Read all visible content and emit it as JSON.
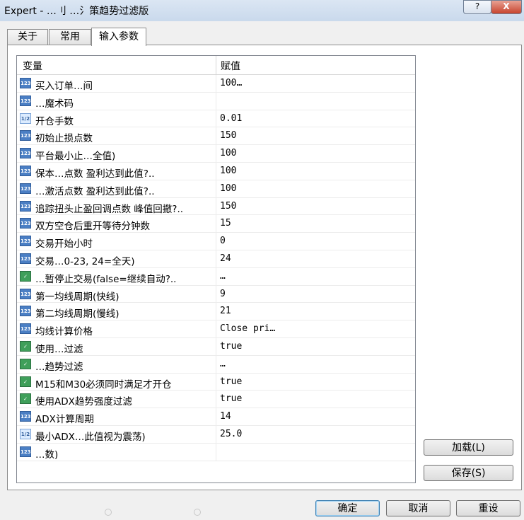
{
  "window": {
    "title": "Expert - …刂  …氵策趋势过滤版",
    "help_label": "?",
    "close_label": "X"
  },
  "tabs": [
    {
      "label": "关于"
    },
    {
      "label": "常用"
    },
    {
      "label": "输入参数"
    }
  ],
  "table": {
    "col_variable": "变量",
    "col_value": "赋值",
    "rows": [
      {
        "icon": "int-icon",
        "name": "买入订单…间",
        "value": "100…"
      },
      {
        "icon": "int-icon",
        "name": "…魔术码",
        "value": ""
      },
      {
        "icon": "double-icon",
        "name": "开仓手数",
        "value": "0.01"
      },
      {
        "icon": "int-icon",
        "name": "初始止损点数",
        "value": "150"
      },
      {
        "icon": "int-icon",
        "name": "平台最小止…全值)",
        "value": "100"
      },
      {
        "icon": "int-icon",
        "name": "保本…点数 盈利达到此值?..",
        "value": "100"
      },
      {
        "icon": "int-icon",
        "name": "…激活点数 盈利达到此值?..",
        "value": "100"
      },
      {
        "icon": "int-icon",
        "name": "追踪扭头止盈回调点数 峰值回撤?..",
        "value": "150"
      },
      {
        "icon": "int-icon",
        "name": "双方空仓后重开等待分钟数",
        "value": "15"
      },
      {
        "icon": "int-icon",
        "name": "交易开始小时",
        "value": "0"
      },
      {
        "icon": "int-icon",
        "name": "交易…0-23, 24=全天)",
        "value": "24"
      },
      {
        "icon": "bool-icon",
        "name": "…暂停止交易(false=继续自动?..",
        "value": "…"
      },
      {
        "icon": "int-icon",
        "name": "第一均线周期(快线)",
        "value": "9"
      },
      {
        "icon": "int-icon",
        "name": "第二均线周期(慢线)",
        "value": "21"
      },
      {
        "icon": "int-icon",
        "name": "均线计算价格",
        "value": "Close pri…"
      },
      {
        "icon": "bool-icon",
        "name": "使用…过滤",
        "value": "true"
      },
      {
        "icon": "bool-icon",
        "name": "…趋势过滤",
        "value": "…"
      },
      {
        "icon": "bool-icon",
        "name": "M15和M30必须同时满足才开仓",
        "value": "true"
      },
      {
        "icon": "bool-icon",
        "name": "使用ADX趋势强度过滤",
        "value": "true"
      },
      {
        "icon": "int-icon",
        "name": "ADX计算周期",
        "value": "14"
      },
      {
        "icon": "double-icon",
        "name": "最小ADX…此值视为震荡)",
        "value": "25.0"
      },
      {
        "icon": "int-icon",
        "name": "…数)",
        "value": ""
      }
    ]
  },
  "buttons": {
    "load": "加载(L)",
    "save": "保存(S)",
    "ok": "确定",
    "cancel": "取消",
    "reset": "重设"
  },
  "icon_glyphs": {
    "int-icon": "123",
    "double-icon": "1/2",
    "bool-icon": "✓"
  }
}
